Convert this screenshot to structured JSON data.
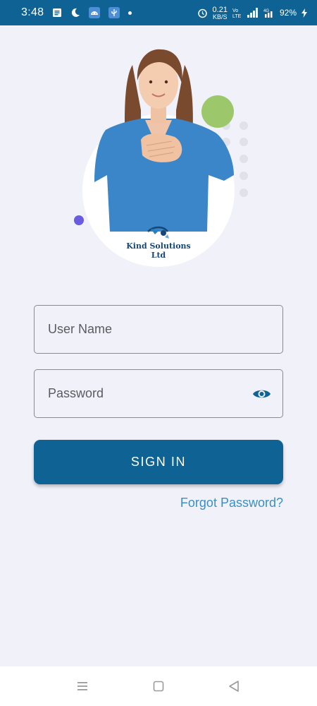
{
  "status_bar": {
    "time": "3:48",
    "net_speed_value": "0.21",
    "net_speed_unit": "KB/S",
    "battery": "92%",
    "icons": [
      "notes-icon",
      "moon-icon",
      "android-icon",
      "usb-icon",
      "alarm-icon",
      "volte-icon",
      "signal-icon",
      "4g-icon",
      "charging-icon"
    ]
  },
  "hero": {
    "brand": "Kind Solutions Ltd",
    "accent_colors": {
      "green": "#9dc76b",
      "purple": "#6a5ce0",
      "scrubs": "#3a86c8"
    }
  },
  "form": {
    "username_placeholder": "User Name",
    "password_placeholder": "Password",
    "password_toggle_icon": "eye-icon"
  },
  "actions": {
    "signin_label": "SIGN IN",
    "forgot_label": "Forgot Password?"
  },
  "theme": {
    "primary": "#0f6394",
    "link": "#3b8fc4",
    "background": "#f1f1f9"
  },
  "nav_bar": {
    "icons": [
      "menu-icon",
      "home-icon",
      "back-icon"
    ]
  }
}
